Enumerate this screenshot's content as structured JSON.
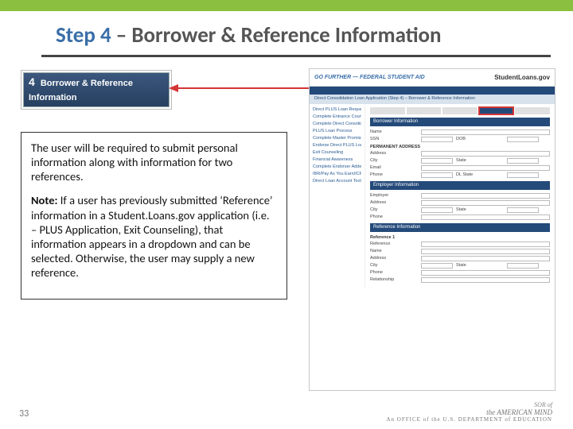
{
  "accent_green": "#8bbf3f",
  "accent_blue": "#3a6ea8",
  "accent_red": "#d43535",
  "title_step": "Step 4",
  "title_rest": "– Borrower & Reference Information",
  "step_tab_num": "4",
  "step_tab_text": "Borrower & Reference Information",
  "para1": "The user will be required to submit personal information along with information for two references.",
  "note_label": "Note:",
  "para2": "If a user has previously submitted ‘Reference’ information in a Student.Loans.gov application (i.e. – PLUS Application, Exit Counseling), that information appears in a dropdown and can be selected.  Otherwise, the user may supply a new reference.",
  "page_number": "33",
  "rc": {
    "logo": "GO FURTHER — FEDERAL STUDENT AID",
    "site": "StudentLoans.gov",
    "crumb": "Direct Consolidation Loan Application (Step 4) – Borrower & Reference Information",
    "sidebar": [
      "Direct PLUS Loan Request",
      "Complete Entrance Counseling",
      "Complete Direct Consolidation Request",
      "PLUS Loan Process",
      "Complete Master Promissory Note",
      "Endorse Direct PLUS Loan",
      "Exit Counseling",
      "Financial Awareness",
      "Complete Endorser Addendum",
      "IBR/Pay As You Earn/ICR Repayment Plan Request",
      "Direct Loan Account Tools"
    ],
    "bar_borrower": "Borrower Information",
    "bar_employer": "Employer Information",
    "bar_reference": "Reference Information",
    "permaddr_hdr": "PERMANENT ADDRESS",
    "ref1_hdr": "Reference 1"
  },
  "footer": {
    "sor": "SOR of",
    "amind": "the AMERICAN MIND",
    "office": "An OFFICE of the U.S. DEPARTMENT of EDUCATION"
  }
}
